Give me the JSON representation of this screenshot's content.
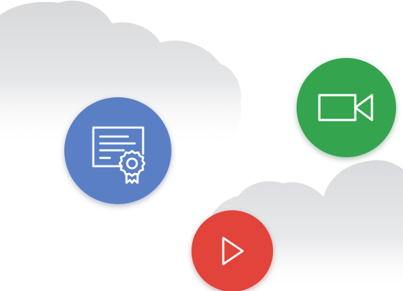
{
  "scene": {
    "colors": {
      "background": "#ffffff",
      "cloud": "#d9dadc",
      "certificate_badge": "#5a7fc4",
      "video_badge": "#34a44e",
      "play_badge": "#e2433a",
      "icon_stroke": "#ffffff"
    },
    "badges": [
      {
        "icon": "certificate-icon",
        "color": "#5a7fc4"
      },
      {
        "icon": "video-camera-icon",
        "color": "#34a44e"
      },
      {
        "icon": "play-icon",
        "color": "#e2433a"
      }
    ]
  }
}
